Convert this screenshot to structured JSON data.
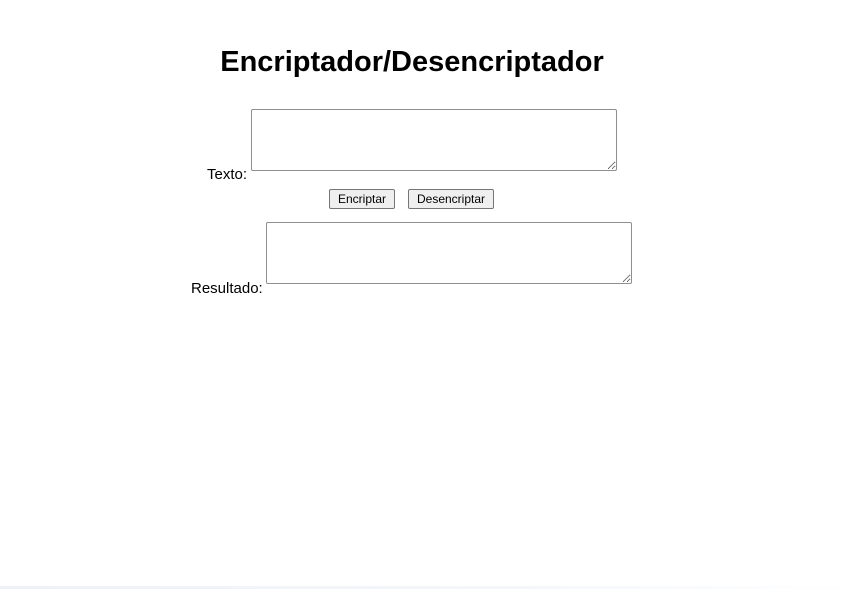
{
  "page": {
    "title": "Encriptador/Desencriptador"
  },
  "form": {
    "input_label": "Texto:",
    "input_value": "",
    "encrypt_label": "Encriptar",
    "decrypt_label": "Desencriptar",
    "result_label": "Resultado:",
    "result_value": ""
  }
}
